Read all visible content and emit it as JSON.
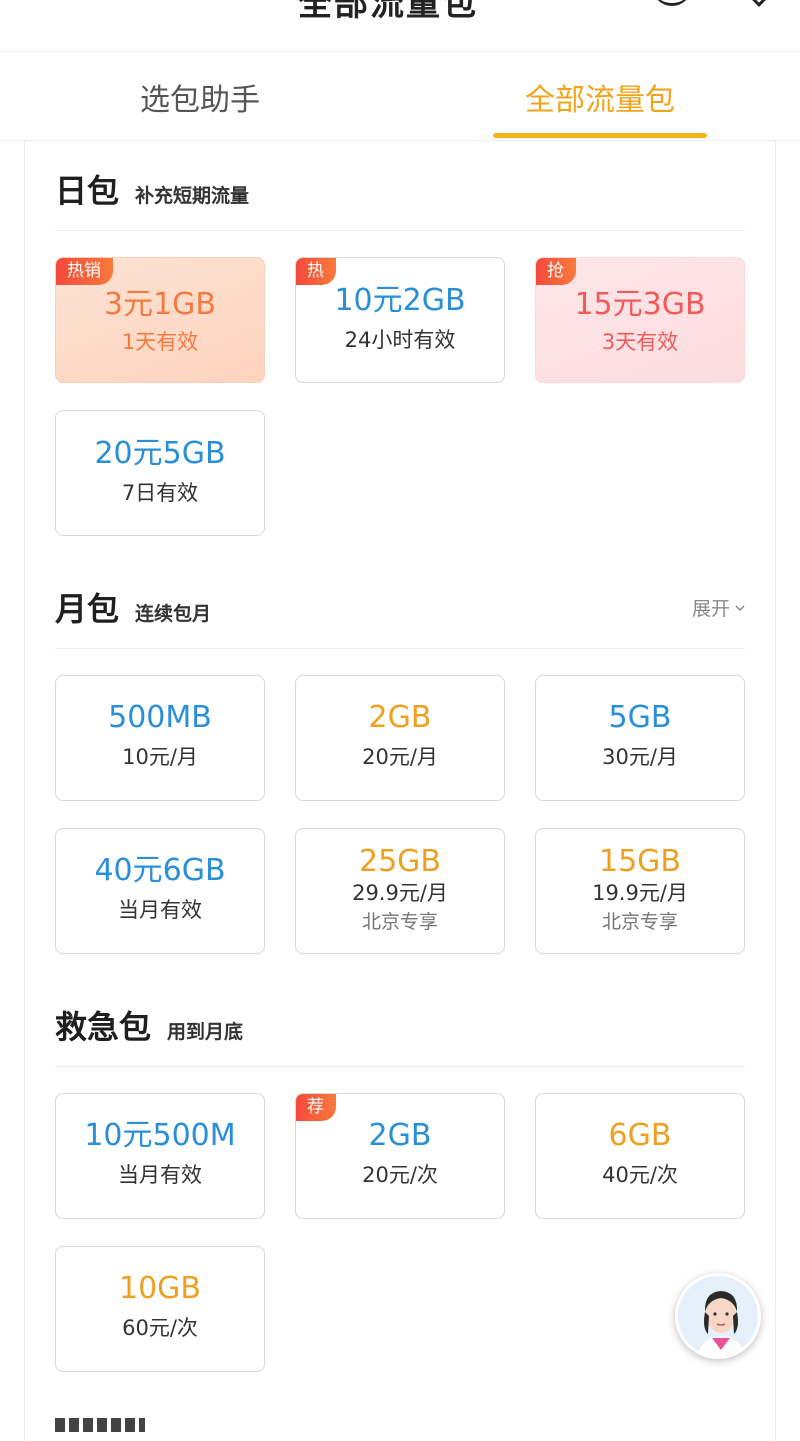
{
  "tabs": [
    {
      "label": "选包助手",
      "active": false
    },
    {
      "label": "全部流量包",
      "active": true
    }
  ],
  "colors": {
    "accent": "#f0a419",
    "blue": "#2a8fd9",
    "orange": "#f0a020",
    "badge": "#f5483c"
  },
  "sections": {
    "daily": {
      "title": "日包",
      "subtitle": "补充短期流量",
      "cards": [
        {
          "badge": "热销",
          "main": "3元1GB",
          "sub": "1天有效"
        },
        {
          "badge": "热",
          "main": "10元2GB",
          "sub": "24小时有效"
        },
        {
          "badge": "抢",
          "main": "15元3GB",
          "sub": "3天有效"
        },
        {
          "main": "20元5GB",
          "sub": "7日有效"
        }
      ]
    },
    "monthly": {
      "title": "月包",
      "subtitle": "连续包月",
      "expand_label": "展开",
      "cards": [
        {
          "main": "500MB",
          "sub": "10元/月"
        },
        {
          "main": "2GB",
          "sub": "20元/月"
        },
        {
          "main": "5GB",
          "sub": "30元/月"
        },
        {
          "main": "40元6GB",
          "sub": "当月有效"
        },
        {
          "main": "25GB",
          "sub": "29.9元/月",
          "note": "北京专享"
        },
        {
          "main": "15GB",
          "sub": "19.9元/月",
          "note": "北京专享"
        }
      ]
    },
    "emergency": {
      "title": "救急包",
      "subtitle": "用到月底",
      "cards": [
        {
          "main": "10元500M",
          "sub": "当月有效"
        },
        {
          "badge": "荐",
          "main": "2GB",
          "sub": "20元/次"
        },
        {
          "main": "6GB",
          "sub": "40元/次"
        },
        {
          "main": "10GB",
          "sub": "60元/次"
        }
      ]
    }
  }
}
